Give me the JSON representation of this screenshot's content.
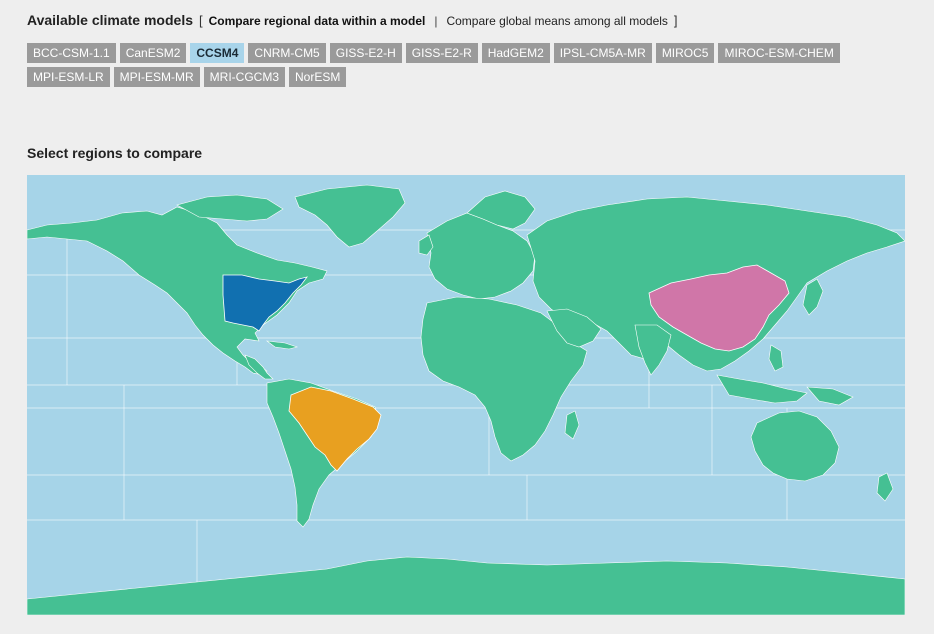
{
  "header": {
    "title": "Available climate models",
    "open_bracket": "[",
    "close_bracket": "]",
    "tab_regional": "Compare regional data within a model",
    "separator": "|",
    "tab_global": "Compare global means among all models"
  },
  "models": [
    {
      "label": "BCC-CSM-1.1",
      "selected": false
    },
    {
      "label": "CanESM2",
      "selected": false
    },
    {
      "label": "CCSM4",
      "selected": true
    },
    {
      "label": "CNRM-CM5",
      "selected": false
    },
    {
      "label": "GISS-E2-H",
      "selected": false
    },
    {
      "label": "GISS-E2-R",
      "selected": false
    },
    {
      "label": "HadGEM2",
      "selected": false
    },
    {
      "label": "IPSL-CM5A-MR",
      "selected": false
    },
    {
      "label": "MIROC5",
      "selected": false
    },
    {
      "label": "MIROC-ESM-CHEM",
      "selected": false
    },
    {
      "label": "MPI-ESM-LR",
      "selected": false
    },
    {
      "label": "MPI-ESM-MR",
      "selected": false
    },
    {
      "label": "MRI-CGCM3",
      "selected": false
    },
    {
      "label": "NorESM",
      "selected": false
    }
  ],
  "regions": {
    "title": "Select regions to compare",
    "selected": [
      {
        "name": "united-states",
        "color": "#1170b0"
      },
      {
        "name": "brazil",
        "color": "#e8a020"
      },
      {
        "name": "china",
        "color": "#d076a8"
      }
    ]
  },
  "colors": {
    "ocean": "#a6d4e8",
    "land": "#45c093",
    "button_bg": "#9a9a9a",
    "button_selected_bg": "#a8d4ea"
  }
}
